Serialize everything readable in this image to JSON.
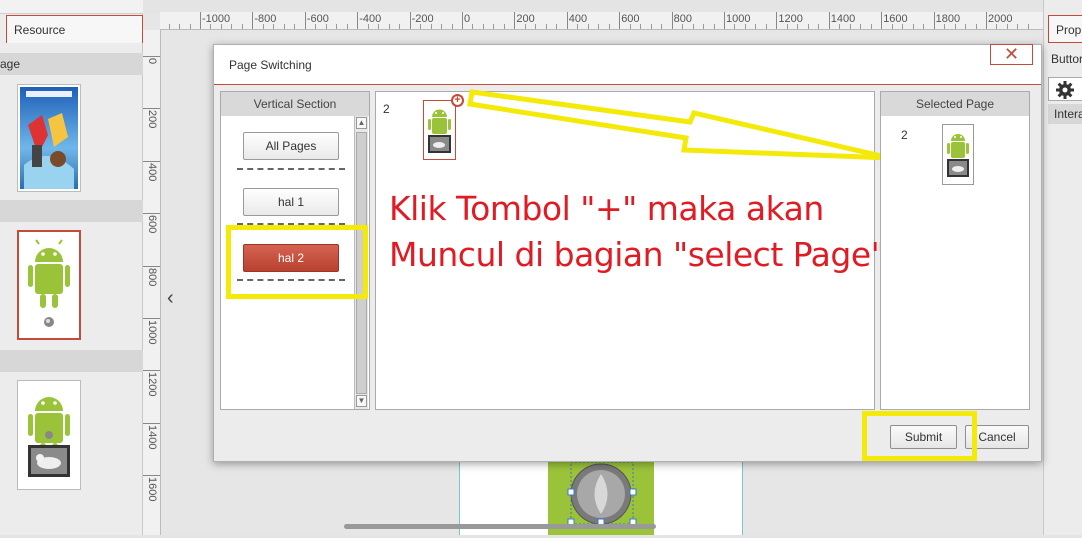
{
  "left_panel": {
    "tab_label": "Resource",
    "section_label": "age",
    "pages": [
      "poster",
      "android",
      "android-with-dog"
    ]
  },
  "right_panel": {
    "tab_label": "Prop",
    "button_label": "Buttor",
    "interact_label": "Intera",
    "gear_icon": "gear-icon"
  },
  "ruler": {
    "top_labels": [
      "-1000",
      "-800",
      "-600",
      "-400",
      "-200",
      "0",
      "200",
      "400",
      "600",
      "800",
      "1000",
      "1200",
      "1400",
      "1600",
      "1800",
      "2000"
    ],
    "left_labels": [
      "0",
      "200",
      "400",
      "600",
      "800",
      "1000",
      "1200",
      "1400",
      "1600"
    ]
  },
  "dialog": {
    "title": "Page Switching",
    "close_label": "✕",
    "vertical_section": {
      "header": "Vertical Section",
      "items": [
        {
          "label": "All Pages",
          "active": false
        },
        {
          "label": "hal 1",
          "active": false
        },
        {
          "label": "hal 2",
          "active": true
        }
      ]
    },
    "pages_column": {
      "page_number": "2",
      "add_icon": "plus-circle-icon"
    },
    "selected_page": {
      "header": "Selected Page",
      "page_number": "2"
    },
    "submit_label": "Submit",
    "cancel_label": "Cancel"
  },
  "annotation": {
    "line1": "Klik Tombol \"+\" maka akan",
    "line2": "Muncul di bagian \"select Page\"",
    "color": "#e01b24",
    "highlight_color": "#f3ea0a"
  },
  "colors": {
    "accent": "#c44a3a",
    "active_button": "#c65040"
  },
  "nav": {
    "back_icon": "chevron-left-icon"
  }
}
